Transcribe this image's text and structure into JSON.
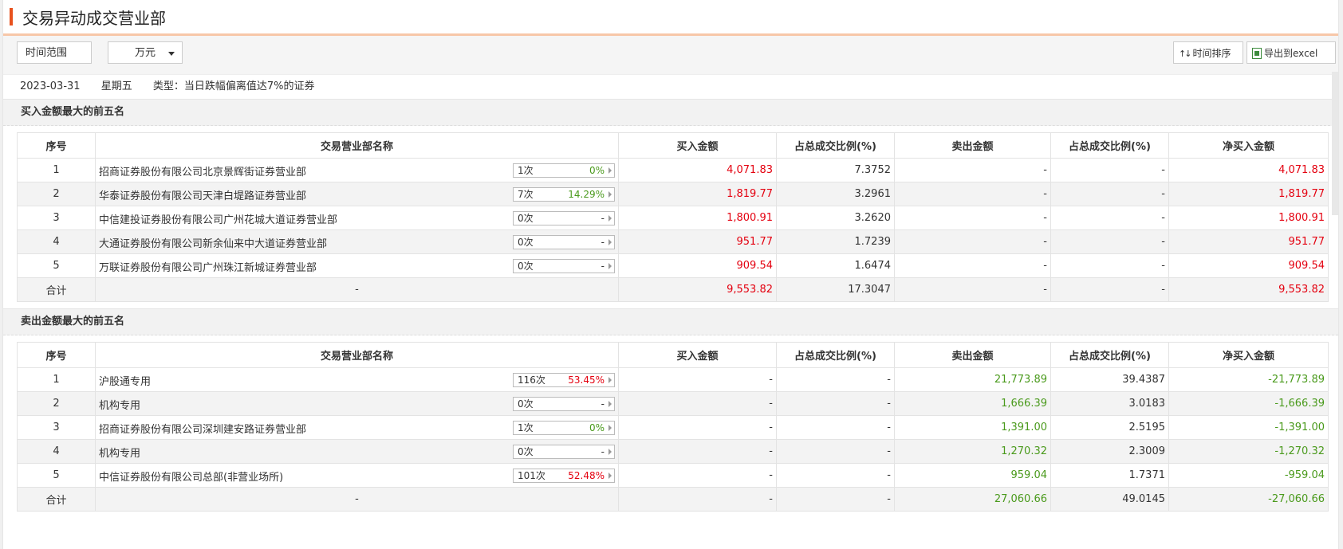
{
  "title": "交易异动成交营业部",
  "toolbar": {
    "range_label": "时间范围",
    "unit_label": "万元",
    "sort_label": "时间排序",
    "export_label": "导出到excel"
  },
  "info": {
    "date": "2023-03-31",
    "weekday": "星期五",
    "type": "类型：当日跌幅偏离值达7%的证券"
  },
  "columns": [
    "序号",
    "交易营业部名称",
    "买入金额",
    "占总成交比例(%)",
    "卖出金额",
    "占总成交比例(%)",
    "净买入金额"
  ],
  "buy": {
    "section_title": "买入金额最大的前五名",
    "rows": [
      {
        "idx": "1",
        "name": "招商证券股份有限公司北京景辉街证券营业部",
        "times": "1次",
        "pct": "0%",
        "pct_color": "green",
        "buy": "4,071.83",
        "buy_ratio": "7.3752",
        "sell": "-",
        "sell_ratio": "-",
        "net": "4,071.83",
        "net_color": "red"
      },
      {
        "idx": "2",
        "name": "华泰证券股份有限公司天津白堤路证券营业部",
        "times": "7次",
        "pct": "14.29%",
        "pct_color": "green",
        "buy": "1,819.77",
        "buy_ratio": "3.2961",
        "sell": "-",
        "sell_ratio": "-",
        "net": "1,819.77",
        "net_color": "red"
      },
      {
        "idx": "3",
        "name": "中信建投证券股份有限公司广州花城大道证券营业部",
        "times": "0次",
        "pct": "-",
        "pct_color": "",
        "buy": "1,800.91",
        "buy_ratio": "3.2620",
        "sell": "-",
        "sell_ratio": "-",
        "net": "1,800.91",
        "net_color": "red"
      },
      {
        "idx": "4",
        "name": "大通证券股份有限公司新余仙来中大道证券营业部",
        "times": "0次",
        "pct": "-",
        "pct_color": "",
        "buy": "951.77",
        "buy_ratio": "1.7239",
        "sell": "-",
        "sell_ratio": "-",
        "net": "951.77",
        "net_color": "red"
      },
      {
        "idx": "5",
        "name": "万联证券股份有限公司广州珠江新城证券营业部",
        "times": "0次",
        "pct": "-",
        "pct_color": "",
        "buy": "909.54",
        "buy_ratio": "1.6474",
        "sell": "-",
        "sell_ratio": "-",
        "net": "909.54",
        "net_color": "red"
      }
    ],
    "total": {
      "label": "合计",
      "name": "-",
      "buy": "9,553.82",
      "buy_ratio": "17.3047",
      "sell": "-",
      "sell_ratio": "-",
      "net": "9,553.82",
      "net_color": "red"
    }
  },
  "sell": {
    "section_title": "卖出金额最大的前五名",
    "rows": [
      {
        "idx": "1",
        "name": "沪股通专用",
        "times": "116次",
        "pct": "53.45%",
        "pct_color": "red",
        "buy": "-",
        "buy_ratio": "-",
        "sell": "21,773.89",
        "sell_ratio": "39.4387",
        "net": "-21,773.89",
        "net_color": "green"
      },
      {
        "idx": "2",
        "name": "机构专用",
        "times": "0次",
        "pct": "-",
        "pct_color": "",
        "buy": "-",
        "buy_ratio": "-",
        "sell": "1,666.39",
        "sell_ratio": "3.0183",
        "net": "-1,666.39",
        "net_color": "green"
      },
      {
        "idx": "3",
        "name": "招商证券股份有限公司深圳建安路证券营业部",
        "times": "1次",
        "pct": "0%",
        "pct_color": "green",
        "buy": "-",
        "buy_ratio": "-",
        "sell": "1,391.00",
        "sell_ratio": "2.5195",
        "net": "-1,391.00",
        "net_color": "green"
      },
      {
        "idx": "4",
        "name": "机构专用",
        "times": "0次",
        "pct": "-",
        "pct_color": "",
        "buy": "-",
        "buy_ratio": "-",
        "sell": "1,270.32",
        "sell_ratio": "2.3009",
        "net": "-1,270.32",
        "net_color": "green"
      },
      {
        "idx": "5",
        "name": "中信证券股份有限公司总部(非营业场所)",
        "times": "101次",
        "pct": "52.48%",
        "pct_color": "red",
        "buy": "-",
        "buy_ratio": "-",
        "sell": "959.04",
        "sell_ratio": "1.7371",
        "net": "-959.04",
        "net_color": "green"
      }
    ],
    "total": {
      "label": "合计",
      "name": "-",
      "buy": "-",
      "buy_ratio": "-",
      "sell": "27,060.66",
      "sell_ratio": "49.0145",
      "net": "-27,060.66",
      "net_color": "green"
    }
  },
  "colors": {
    "accent": "#e8521e",
    "red": "#e4000f",
    "green": "#4a9a1c"
  }
}
